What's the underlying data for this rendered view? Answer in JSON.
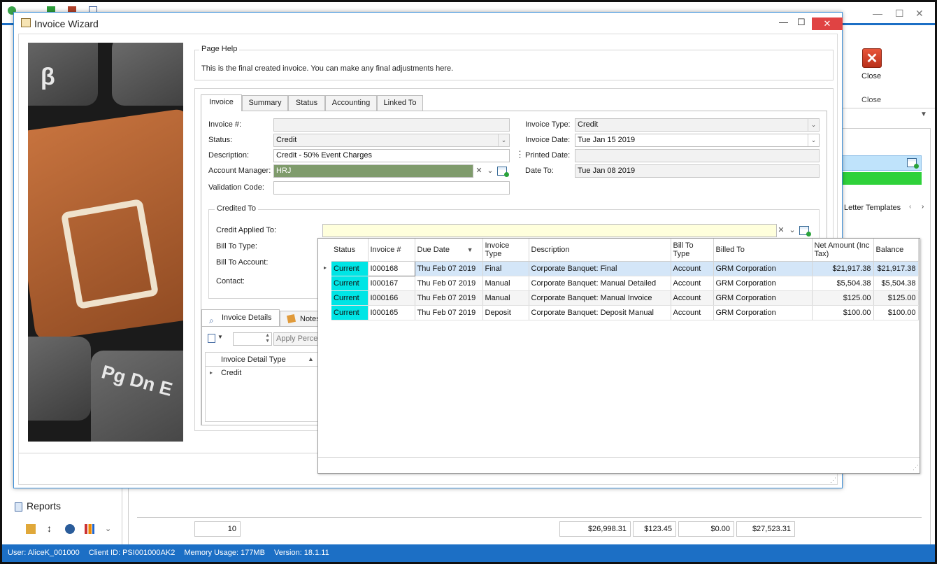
{
  "background_app": {
    "ribbon": {
      "close_label": "Close",
      "close_group_label": "Close"
    },
    "letter_templates_tab": "Letter Templates",
    "sidebar": {
      "reports_label": "Reports"
    },
    "footer": {
      "count": "10",
      "total1": "$26,998.31",
      "total2": "$123.45",
      "total3": "$0.00",
      "total4": "$27,523.31"
    }
  },
  "status_bar": {
    "user": "User: AliceK_001000",
    "client_id": "Client ID: PSI001000AK2",
    "memory": "Memory Usage: 177MB",
    "version": "Version: 18.1.11"
  },
  "wizard": {
    "title": "Invoice Wizard",
    "page_help": {
      "group_label": "Page Help",
      "text": "This is the final created invoice.  You can make any final adjustments here."
    },
    "tabs": [
      {
        "label": "Invoice"
      },
      {
        "label": "Summary"
      },
      {
        "label": "Status"
      },
      {
        "label": "Accounting"
      },
      {
        "label": "Linked To"
      }
    ],
    "form": {
      "invoice_no_label": "Invoice #:",
      "invoice_no_value": "",
      "status_label": "Status:",
      "status_value": "Credit",
      "description_label": "Description:",
      "description_value": "Credit - 50% Event Charges",
      "account_manager_label": "Account Manager:",
      "account_manager_value": "HRJ",
      "validation_code_label": "Validation Code:",
      "validation_code_value": "",
      "invoice_type_label": "Invoice Type:",
      "invoice_type_value": "Credit",
      "invoice_date_label": "Invoice Date:",
      "invoice_date_value": "Tue Jan 15 2019",
      "printed_date_label": "Printed Date:",
      "printed_date_value": "",
      "date_to_label": "Date To:",
      "date_to_value": "Tue Jan 08 2019"
    },
    "credited_to": {
      "group_label": "Credited To",
      "credit_applied_label": "Credit Applied To:",
      "credit_applied_value": "",
      "bill_to_type_label": "Bill To Type:",
      "bill_to_account_label": "Bill To Account:",
      "contact_label": "Contact:"
    },
    "details": {
      "tab_invoice_details": "Invoice Details",
      "tab_notes": "Notes",
      "apply_percent_label": "Apply Percen",
      "column_header": "Invoice Detail Type",
      "row_value": "Credit"
    },
    "popup": {
      "columns": [
        "Status",
        "Invoice #",
        "Due Date",
        "Invoice Type",
        "Description",
        "Bill To Type",
        "Billed To",
        "Net Amount (Inc Tax)",
        "Balance"
      ],
      "rows": [
        [
          "Current",
          "I000168",
          "Thu Feb 07 2019",
          "Final",
          "Corporate Banquet: Final",
          "Account",
          "GRM Corporation",
          "$21,917.38",
          "$21,917.38"
        ],
        [
          "Current",
          "I000167",
          "Thu Feb 07 2019",
          "Manual",
          "Corporate Banquet: Manual Detailed",
          "Account",
          "GRM Corporation",
          "$5,504.38",
          "$5,504.38"
        ],
        [
          "Current",
          "I000166",
          "Thu Feb 07 2019",
          "Manual",
          "Corporate Banquet: Manual Invoice",
          "Account",
          "GRM Corporation",
          "$125.00",
          "$125.00"
        ],
        [
          "Current",
          "I000165",
          "Thu Feb 07 2019",
          "Deposit",
          "Corporate Banquet: Deposit Manual",
          "Account",
          "GRM Corporation",
          "$100.00",
          "$100.00"
        ]
      ]
    }
  },
  "colors": {
    "status_bar": "#1c6fc5",
    "status_cell": "#00e5e5",
    "account_manager_bg": "#7f9b6c",
    "close_button": "#e04343"
  }
}
